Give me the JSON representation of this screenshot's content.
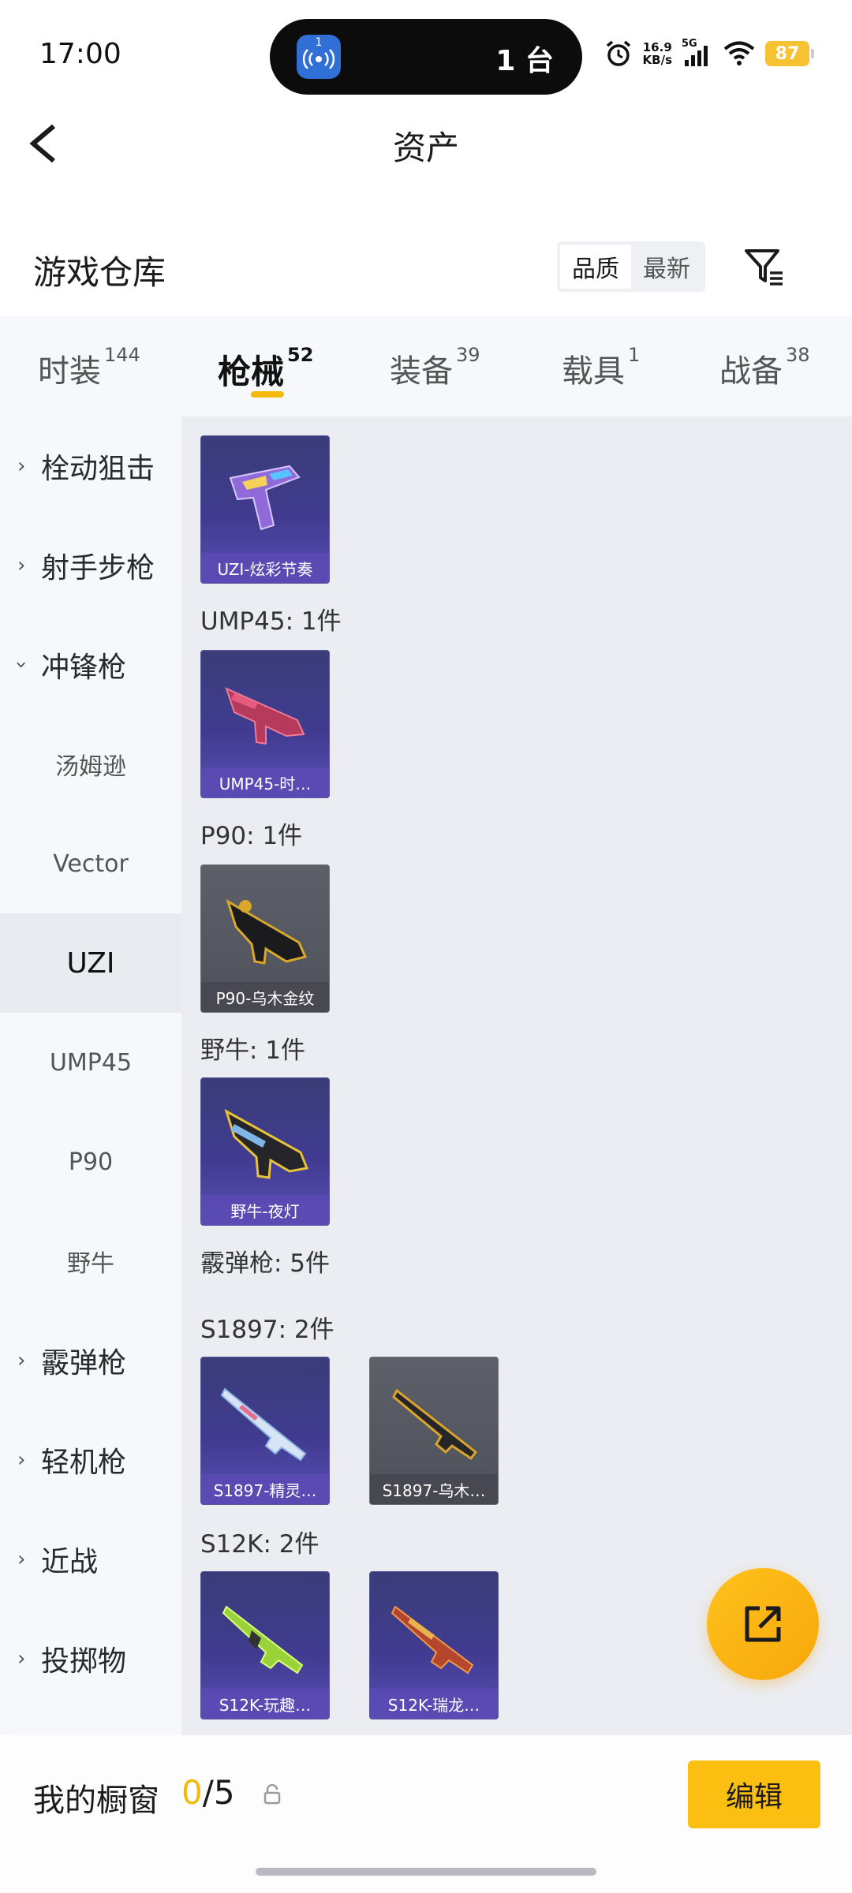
{
  "status_bar": {
    "time": "17:00",
    "island_badge": "1",
    "island_count": "1 台",
    "net_speed_value": "16.9",
    "net_speed_unit": "KB/s",
    "network": "5G",
    "battery": "87"
  },
  "header": {
    "title": "资产"
  },
  "warehouse": {
    "title": "游戏仓库",
    "sort_options": [
      "品质",
      "最新"
    ],
    "sort_selected": "品质"
  },
  "tabs": [
    {
      "label": "时装",
      "count": "144"
    },
    {
      "label": "枪械",
      "count": "52",
      "active": true
    },
    {
      "label": "装备",
      "count": "39"
    },
    {
      "label": "载具",
      "count": "1"
    },
    {
      "label": "战备",
      "count": "38"
    }
  ],
  "sidebar": [
    {
      "label": "栓动狙击",
      "type": "category",
      "expanded": false
    },
    {
      "label": "射手步枪",
      "type": "category",
      "expanded": false
    },
    {
      "label": "冲锋枪",
      "type": "category",
      "expanded": true
    },
    {
      "label": "汤姆逊",
      "type": "sub"
    },
    {
      "label": "Vector",
      "type": "sub"
    },
    {
      "label": "UZI",
      "type": "sub",
      "selected": true
    },
    {
      "label": "UMP45",
      "type": "sub"
    },
    {
      "label": "P90",
      "type": "sub"
    },
    {
      "label": "野牛",
      "type": "sub"
    },
    {
      "label": "霰弹枪",
      "type": "category",
      "expanded": false
    },
    {
      "label": "轻机枪",
      "type": "category",
      "expanded": false
    },
    {
      "label": "近战",
      "type": "category",
      "expanded": false
    },
    {
      "label": "投掷物",
      "type": "category",
      "expanded": false
    }
  ],
  "content": {
    "sections": [
      {
        "label": "UMP45: 1件"
      },
      {
        "label": "P90: 1件"
      },
      {
        "label": "野牛: 1件"
      },
      {
        "label": "霰弹枪: 5件"
      },
      {
        "label": "S1897: 2件"
      },
      {
        "label": "S12K: 2件"
      }
    ],
    "items": [
      {
        "name": "UZI-炫彩节奏",
        "style": "purple"
      },
      {
        "name": "UMP45-时…",
        "style": "purple"
      },
      {
        "name": "P90-乌木金纹",
        "style": "gray"
      },
      {
        "name": "野牛-夜灯",
        "style": "purple"
      },
      {
        "name": "S1897-精灵…",
        "style": "purple"
      },
      {
        "name": "S1897-乌木…",
        "style": "gray"
      },
      {
        "name": "S12K-玩趣…",
        "style": "purple"
      },
      {
        "name": "S12K-瑞龙…",
        "style": "purple"
      }
    ]
  },
  "fab": {
    "icon": "share-external-icon"
  },
  "showcase": {
    "label": "我的橱窗",
    "current": "0",
    "separator_total": "/5",
    "edit_label": "编辑"
  },
  "colors": {
    "accent": "#f5b80c",
    "purple_card": "#403b90",
    "gray_card": "#55585f"
  }
}
